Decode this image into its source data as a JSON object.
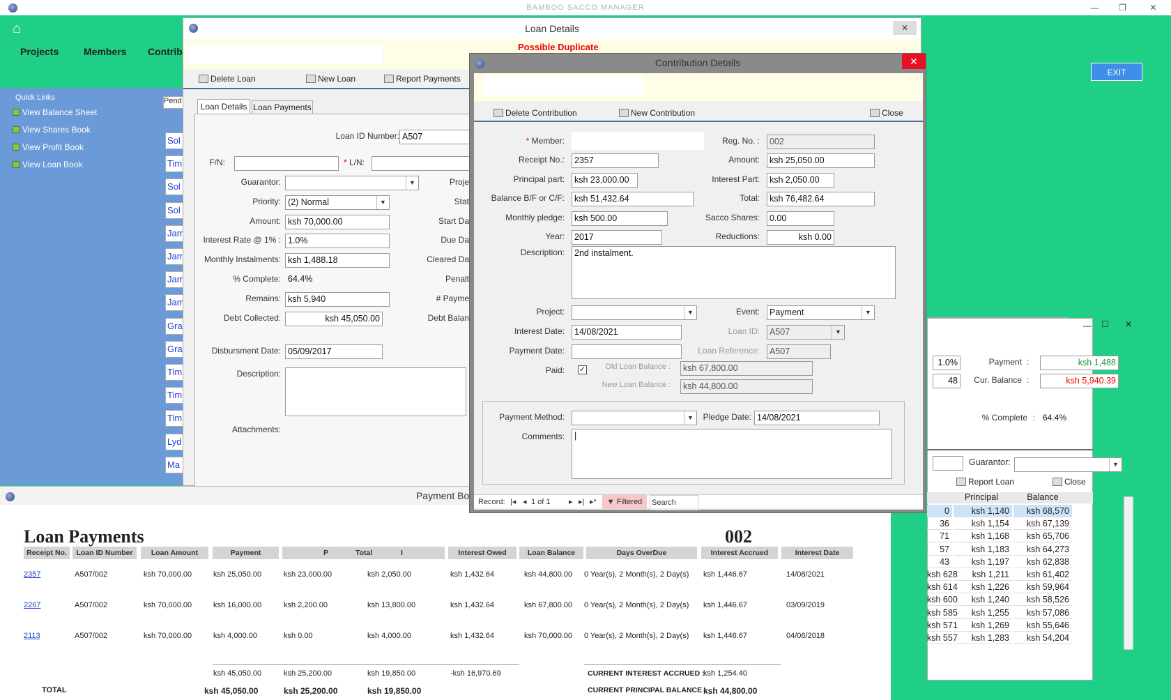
{
  "app": {
    "title": "BAMBOO SACCO MANAGER",
    "exit_label": "EXIT"
  },
  "nav": {
    "projects": "Projects",
    "members": "Members",
    "contrib": "Contrib"
  },
  "quick_links": {
    "title": "Quick Links",
    "items": [
      "View Balance Sheet",
      "View Shares Book",
      "View Profit Book",
      "View Loan Book"
    ]
  },
  "pend_tab": "Pend",
  "side_names": [
    "Sol",
    "Tim",
    "Sol",
    "Sol",
    "Jam",
    "Jam",
    "Jam",
    "Jam",
    "Gra",
    "Gra",
    "Tim",
    "Tim",
    "Tim",
    "Lyd",
    "Ma"
  ],
  "loan": {
    "title": "Loan Details",
    "duplicate": "Possible Duplicate",
    "toolbar": {
      "delete": "Delete Loan",
      "new": "New Loan",
      "report": "Report Payments"
    },
    "tabs": [
      "Loan Details",
      "Loan Payments"
    ],
    "labels": {
      "loan_id": "Loan ID Number:",
      "fn": "F/N:",
      "ln": "L/N:",
      "guarantor": "Guarantor:",
      "priority": "Priority:",
      "amount": "Amount:",
      "rate": "Interest Rate @ 1% :",
      "monthly": "Monthly Instalments:",
      "complete": "% Complete:",
      "remains": "Remains:",
      "debt": "Debt Collected:",
      "disb": "Disbursment Date:",
      "desc": "Description:",
      "attach": "Attachments:",
      "proj": "Proje",
      "stat": "Stat",
      "start": "Start Da",
      "due": "Due Da",
      "cleared": "Cleared Da",
      "penalt": "Penalt",
      "paym": "# Payme",
      "debtbal": "Debt Balan"
    },
    "values": {
      "loan_id": "A507",
      "priority": "(2) Normal",
      "amount": "ksh 70,000.00",
      "rate": "1.0%",
      "monthly": "ksh 1,488.18",
      "complete": "64.4%",
      "remains": "ksh 5,940",
      "debt": "ksh 45,050.00",
      "disb": "05/09/2017"
    }
  },
  "contrib": {
    "title": "Contribution Details",
    "toolbar": {
      "delete": "Delete Contribution",
      "new": "New Contribution",
      "close": "Close"
    },
    "labels": {
      "member": "Member:",
      "receipt": "Receipt No.:",
      "principal": "Principal part:",
      "balance": "Balance B/F or C/F:",
      "pledge": "Monthly pledge:",
      "year": "Year:",
      "desc": "Description:",
      "project": "Project:",
      "int_date": "Interest Date:",
      "pay_date": "Payment Date:",
      "paid": "Paid:",
      "reg": "Reg. No. :",
      "amount": "Amount:",
      "int_part": "Interest Part:",
      "total": "Total:",
      "shares": "Sacco Shares:",
      "reductions": "Reductions:",
      "event": "Event:",
      "loan_id": "Loan ID:",
      "loan_ref": "Loan Reference:",
      "old_bal": "Old Loan Balance :",
      "new_bal": "New Loan Balance :",
      "method": "Payment Method:",
      "pledge_date": "Pledge Date:",
      "comments": "Comments:"
    },
    "values": {
      "receipt": "2357",
      "principal": "ksh 23,000.00",
      "balance": "ksh 51,432.64",
      "pledge": "ksh 500.00",
      "year": "2017",
      "desc": "2nd instalment.",
      "int_date": "14/08/2021",
      "reg": "002",
      "amount": "ksh 25,050.00",
      "int_part": "ksh 2,050.00",
      "total": "ksh 76,482.64",
      "shares": "0.00",
      "reductions": "ksh 0.00",
      "event": "Payment",
      "loan_id": "A507",
      "loan_ref": "A507",
      "old_bal": "ksh 67,800.00",
      "new_bal": "ksh 44,800.00",
      "pledge_date": "14/08/2021",
      "comments": "|"
    },
    "nav": {
      "record": "Record:",
      "of": "1 of 1",
      "filtered": "Filtered",
      "search": "Search"
    }
  },
  "right": {
    "rate": "1.0%",
    "n": "48",
    "payment_lbl": "Payment",
    "payment": "ksh 1,488",
    "curbal_lbl": "Cur. Balance",
    "curbal": "ksh 5,940.39",
    "complete_lbl": "% Complete",
    "complete": "64.4%",
    "colon": ":",
    "guarantor_lbl": "Guarantor:",
    "report": "Report Loan",
    "close": "Close",
    "grid_headers": [
      "Principal",
      "Balance"
    ],
    "grid_rows": [
      [
        "0",
        "ksh 1,140",
        "ksh 68,570"
      ],
      [
        "36",
        "ksh 1,154",
        "ksh 67,139"
      ],
      [
        "71",
        "ksh 1,168",
        "ksh 65,706"
      ],
      [
        "57",
        "ksh 1,183",
        "ksh 64,273"
      ],
      [
        "43",
        "ksh 1,197",
        "ksh 62,838"
      ],
      [
        "ksh 628",
        "ksh 1,211",
        "ksh 61,402"
      ],
      [
        "ksh 614",
        "ksh 1,226",
        "ksh 59,964"
      ],
      [
        "ksh 600",
        "ksh 1,240",
        "ksh 58,526"
      ],
      [
        "ksh 585",
        "ksh 1,255",
        "ksh 57,086"
      ],
      [
        "ksh 571",
        "ksh 1,269",
        "ksh 55,646"
      ],
      [
        "ksh 557",
        "ksh 1,283",
        "ksh 54,204"
      ]
    ]
  },
  "report": {
    "window_title": "Payment Boo",
    "heading": "Loan Payments",
    "reg": "002",
    "headers": [
      "Receipt No.",
      "Loan ID Number",
      "Loan Amount",
      "Payment",
      "P",
      "Total",
      "I",
      "Interest Owed",
      "Loan Balance",
      "Days OverDue",
      "Interest Accrued",
      "Interest Date"
    ],
    "rows": [
      [
        "2357",
        "A507/002",
        "ksh 70,000.00",
        "ksh 25,050.00",
        "ksh 23,000.00",
        "ksh 2,050.00",
        "ksh 1,432.64",
        "ksh 44,800.00",
        "0 Year(s), 2 Month(s), 2 Day(s)",
        "ksh 1,446.67",
        "14/08/2021"
      ],
      [
        "2267",
        "A507/002",
        "ksh 70,000.00",
        "ksh 16,000.00",
        "ksh 2,200.00",
        "ksh 13,800.00",
        "ksh 1,432.64",
        "ksh 67,800.00",
        "0 Year(s), 2 Month(s), 2 Day(s)",
        "ksh 1,446.67",
        "03/09/2019"
      ],
      [
        "2113",
        "A507/002",
        "ksh 70,000.00",
        "ksh 4,000.00",
        "ksh 0.00",
        "ksh 4,000.00",
        "ksh 1,432.64",
        "ksh 70,000.00",
        "0 Year(s), 2 Month(s), 2 Day(s)",
        "ksh 1,446.67",
        "04/06/2018"
      ]
    ],
    "subtotals": [
      "ksh 45,050.00",
      "ksh 25,200.00",
      "ksh 19,850.00",
      "-ksh 16,970.69"
    ],
    "total_label": "TOTAL",
    "totals": [
      "ksh 45,050.00",
      "ksh 25,200.00",
      "ksh 19,850.00"
    ],
    "cur_int_lbl": "CURRENT INTEREST ACCRUED :",
    "cur_int": "ksh 1,254.40",
    "cur_prin_lbl": "CURRENT PRINCIPAL BALANCE :",
    "cur_prin": "ksh 44,800.00"
  }
}
